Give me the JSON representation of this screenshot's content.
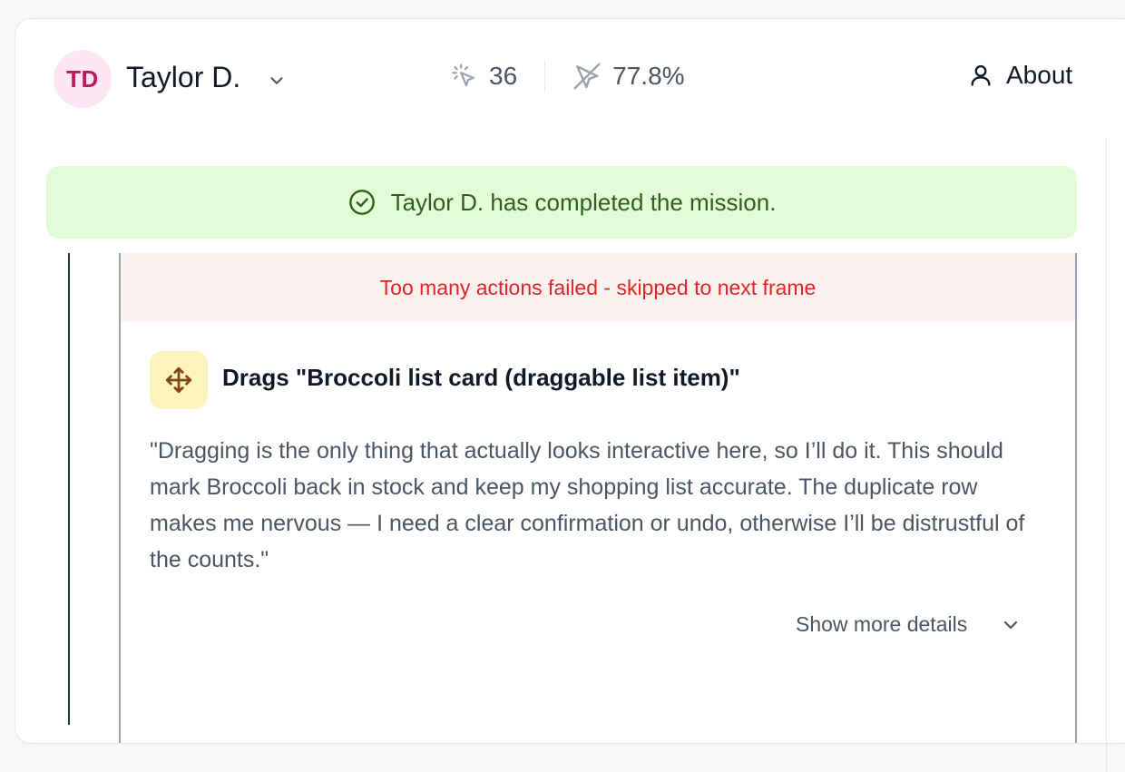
{
  "user": {
    "initials": "TD",
    "name": "Taylor D."
  },
  "stats": {
    "clicks_value": "36",
    "misclick_rate": "77.8%"
  },
  "about": {
    "label": "About"
  },
  "banner": {
    "message": "Taylor D. has completed the mission."
  },
  "step": {
    "error_message": "Too many actions failed - skipped to next frame",
    "action_title": "Drags \"Broccoli list card (draggable list item)\"",
    "quote": "\"Dragging is the only thing that actually looks interactive here, so I’ll do it. This should mark Broccoli back in stock and keep my shopping list accurate. The duplicate row makes me nervous — I need a clear confirmation or undo, otherwise I’ll be distrustful of the counts.\"",
    "details_label": "Show more details"
  },
  "icons": {
    "user_menu": "chevron-down-icon",
    "clicks": "pointer-click-icon",
    "misclicks": "pointer-off-icon",
    "about": "user-icon",
    "banner": "check-circle-icon",
    "action": "move-arrows-icon",
    "details": "chevron-down-icon"
  },
  "colors": {
    "avatar_bg": "#fce7f3",
    "avatar_text": "#be185d",
    "success_bg": "#e2fcd7",
    "success_text": "#2f5f1d",
    "error_bg": "#fdf0f0",
    "error_text": "#dc2626",
    "action_icon_bg": "#fef3bd",
    "action_icon_fg": "#7c4a12"
  }
}
